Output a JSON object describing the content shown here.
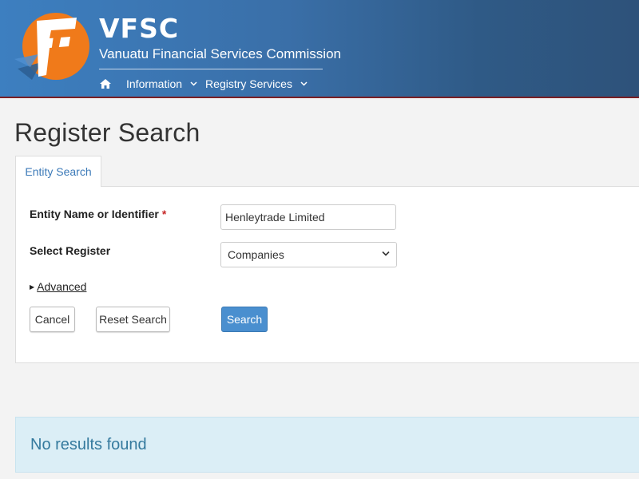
{
  "header": {
    "brand": "VFSC",
    "subtitle": "Vanuatu Financial Services Commission",
    "nav": [
      {
        "label": "Information"
      },
      {
        "label": "Registry Services"
      }
    ]
  },
  "page": {
    "title": "Register Search",
    "tabs": [
      {
        "label": "Entity Search",
        "active": true
      }
    ]
  },
  "form": {
    "entity_label": "Entity Name or Identifier",
    "required_marker": "*",
    "entity_value": "Henleytrade Limited",
    "register_label": "Select Register",
    "register_value": "Companies",
    "advanced_label": "Advanced"
  },
  "buttons": {
    "cancel": "Cancel",
    "reset": "Reset Search",
    "search": "Search"
  },
  "alert": {
    "message": "No results found"
  },
  "icons": {
    "home": "home-icon",
    "nav_chevron": "chevron-down-icon",
    "select_caret": "chevron-down-icon",
    "advanced_toggle": "triangle-right-icon"
  },
  "colors": {
    "header_blue": "#3a6fa8",
    "header_border": "#7a1f24",
    "logo_orange": "#f07a1a",
    "primary_button": "#4a8fcf",
    "link_tab": "#3c7ab8",
    "required": "#c62828",
    "alert_bg": "#dbeef6",
    "alert_text": "#357a9e"
  }
}
